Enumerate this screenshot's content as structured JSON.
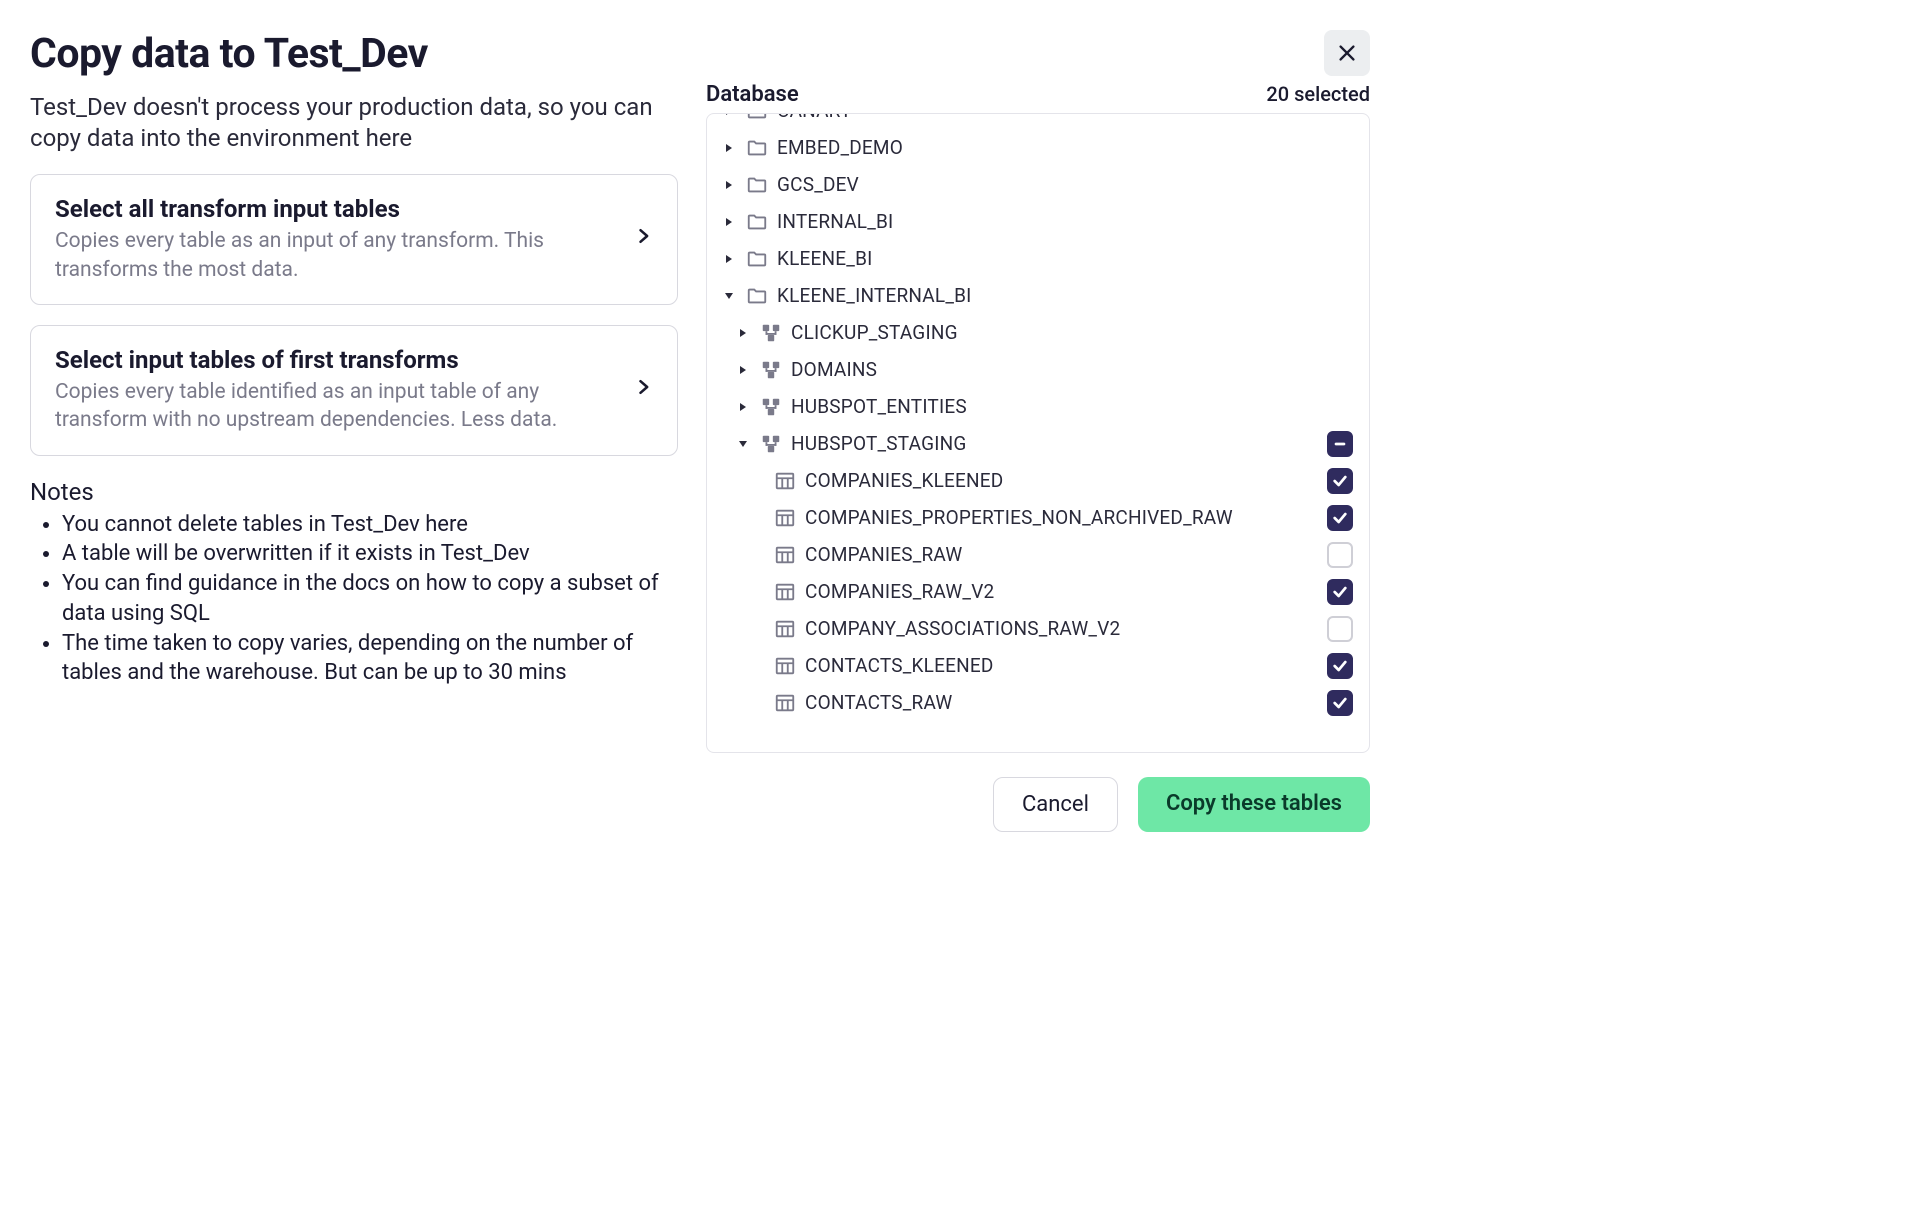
{
  "title": "Copy data to Test_Dev",
  "subtitle": "Test_Dev doesn't process your production data, so you can copy data into the environment here",
  "options": [
    {
      "title": "Select all transform input tables",
      "desc": "Copies every table as an input of any transform. This transforms the most data."
    },
    {
      "title": "Select input tables of first transforms",
      "desc": "Copies every table identified as an input table of any transform with no upstream dependencies. Less data."
    }
  ],
  "notes_heading": "Notes",
  "notes": [
    "You cannot delete tables in Test_Dev here",
    "A table will be overwritten if it exists in Test_Dev",
    "You can find guidance in the docs on how to copy a subset of data using SQL",
    "The time taken to copy varies, depending on the number of tables and the warehouse. But can be up to 30 mins"
  ],
  "db_heading": "Database",
  "selected_text": "20 selected",
  "tree": [
    {
      "depth": 0,
      "kind": "folder",
      "caret": "right",
      "label": "CANARY",
      "cut_top": true
    },
    {
      "depth": 0,
      "kind": "folder",
      "caret": "right",
      "label": "EMBED_DEMO"
    },
    {
      "depth": 0,
      "kind": "folder",
      "caret": "right",
      "label": "GCS_DEV"
    },
    {
      "depth": 0,
      "kind": "folder",
      "caret": "right",
      "label": "INTERNAL_BI"
    },
    {
      "depth": 0,
      "kind": "folder",
      "caret": "right",
      "label": "KLEENE_BI"
    },
    {
      "depth": 0,
      "kind": "folder",
      "caret": "down",
      "label": "KLEENE_INTERNAL_BI"
    },
    {
      "depth": 1,
      "kind": "schema",
      "caret": "right",
      "label": "CLICKUP_STAGING"
    },
    {
      "depth": 1,
      "kind": "schema",
      "caret": "right",
      "label": "DOMAINS"
    },
    {
      "depth": 1,
      "kind": "schema",
      "caret": "right",
      "label": "HUBSPOT_ENTITIES"
    },
    {
      "depth": 1,
      "kind": "schema",
      "caret": "down",
      "label": "HUBSPOT_STAGING",
      "checkbox": "mixed"
    },
    {
      "depth": 2,
      "kind": "table",
      "label": "COMPANIES_KLEENED",
      "checkbox": "checked"
    },
    {
      "depth": 2,
      "kind": "table",
      "label": "COMPANIES_PROPERTIES_NON_ARCHIVED_RAW",
      "checkbox": "checked"
    },
    {
      "depth": 2,
      "kind": "table",
      "label": "COMPANIES_RAW",
      "checkbox": "unchecked"
    },
    {
      "depth": 2,
      "kind": "table",
      "label": "COMPANIES_RAW_V2",
      "checkbox": "checked"
    },
    {
      "depth": 2,
      "kind": "table",
      "label": "COMPANY_ASSOCIATIONS_RAW_V2",
      "checkbox": "unchecked"
    },
    {
      "depth": 2,
      "kind": "table",
      "label": "CONTACTS_KLEENED",
      "checkbox": "checked"
    },
    {
      "depth": 2,
      "kind": "table",
      "label": "CONTACTS_RAW",
      "checkbox": "checked"
    }
  ],
  "buttons": {
    "cancel": "Cancel",
    "copy": "Copy these tables"
  }
}
